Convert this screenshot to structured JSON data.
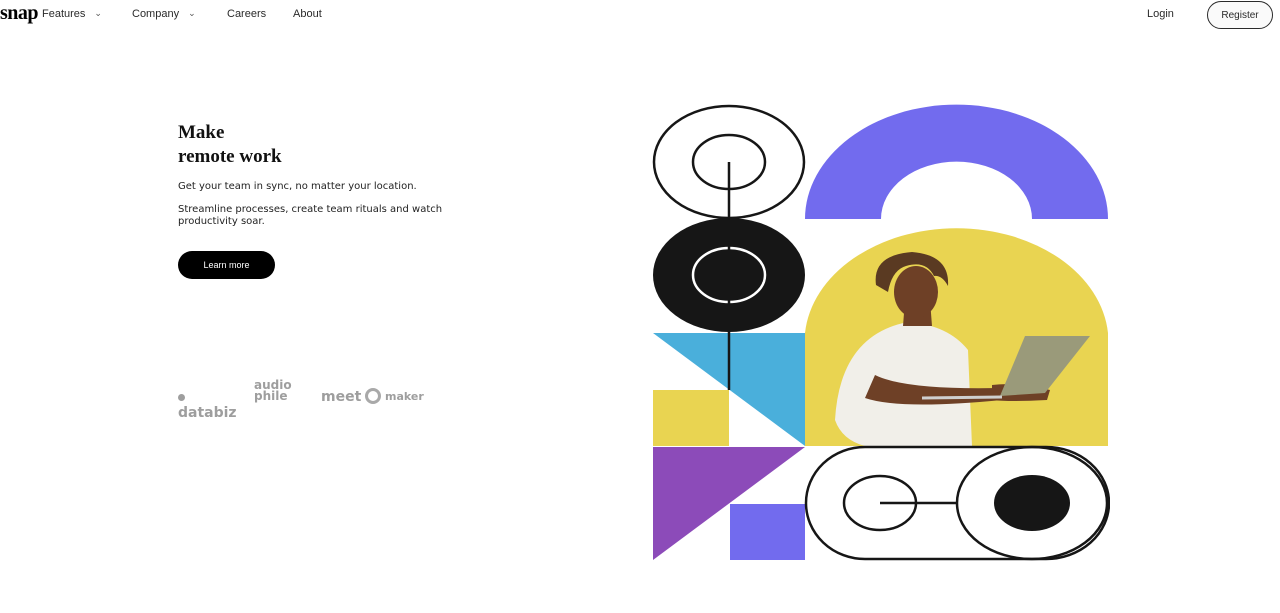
{
  "nav": {
    "logo": "snap",
    "items": [
      {
        "label": "Features",
        "has_dropdown": true
      },
      {
        "label": "Company",
        "has_dropdown": true
      },
      {
        "label": "Careers",
        "has_dropdown": false
      },
      {
        "label": "About",
        "has_dropdown": false
      }
    ],
    "chevron_glyph": "⌄",
    "login": "Login",
    "register": "Register"
  },
  "hero": {
    "title_line1": "Make",
    "title_line2": "remote work",
    "paragraph1": "Get your team in sync, no matter your location.",
    "paragraph2": "Streamline processes, create team rituals and watch productivity soar.",
    "cta_label": "Learn more"
  },
  "clients": {
    "databiz": "databiz",
    "audiophile_top": "audio",
    "audiophile_bottom": "phile",
    "meet": "meet",
    "maker": "maker"
  },
  "colors": {
    "purple": "#726bee",
    "blue": "#4aafdb",
    "yellow": "#e9d451",
    "violet": "#8c4bb9",
    "black": "#161616",
    "logo_gray": "#9e9e9e"
  },
  "illustration": {
    "photo_subject": "man-with-laptop"
  }
}
